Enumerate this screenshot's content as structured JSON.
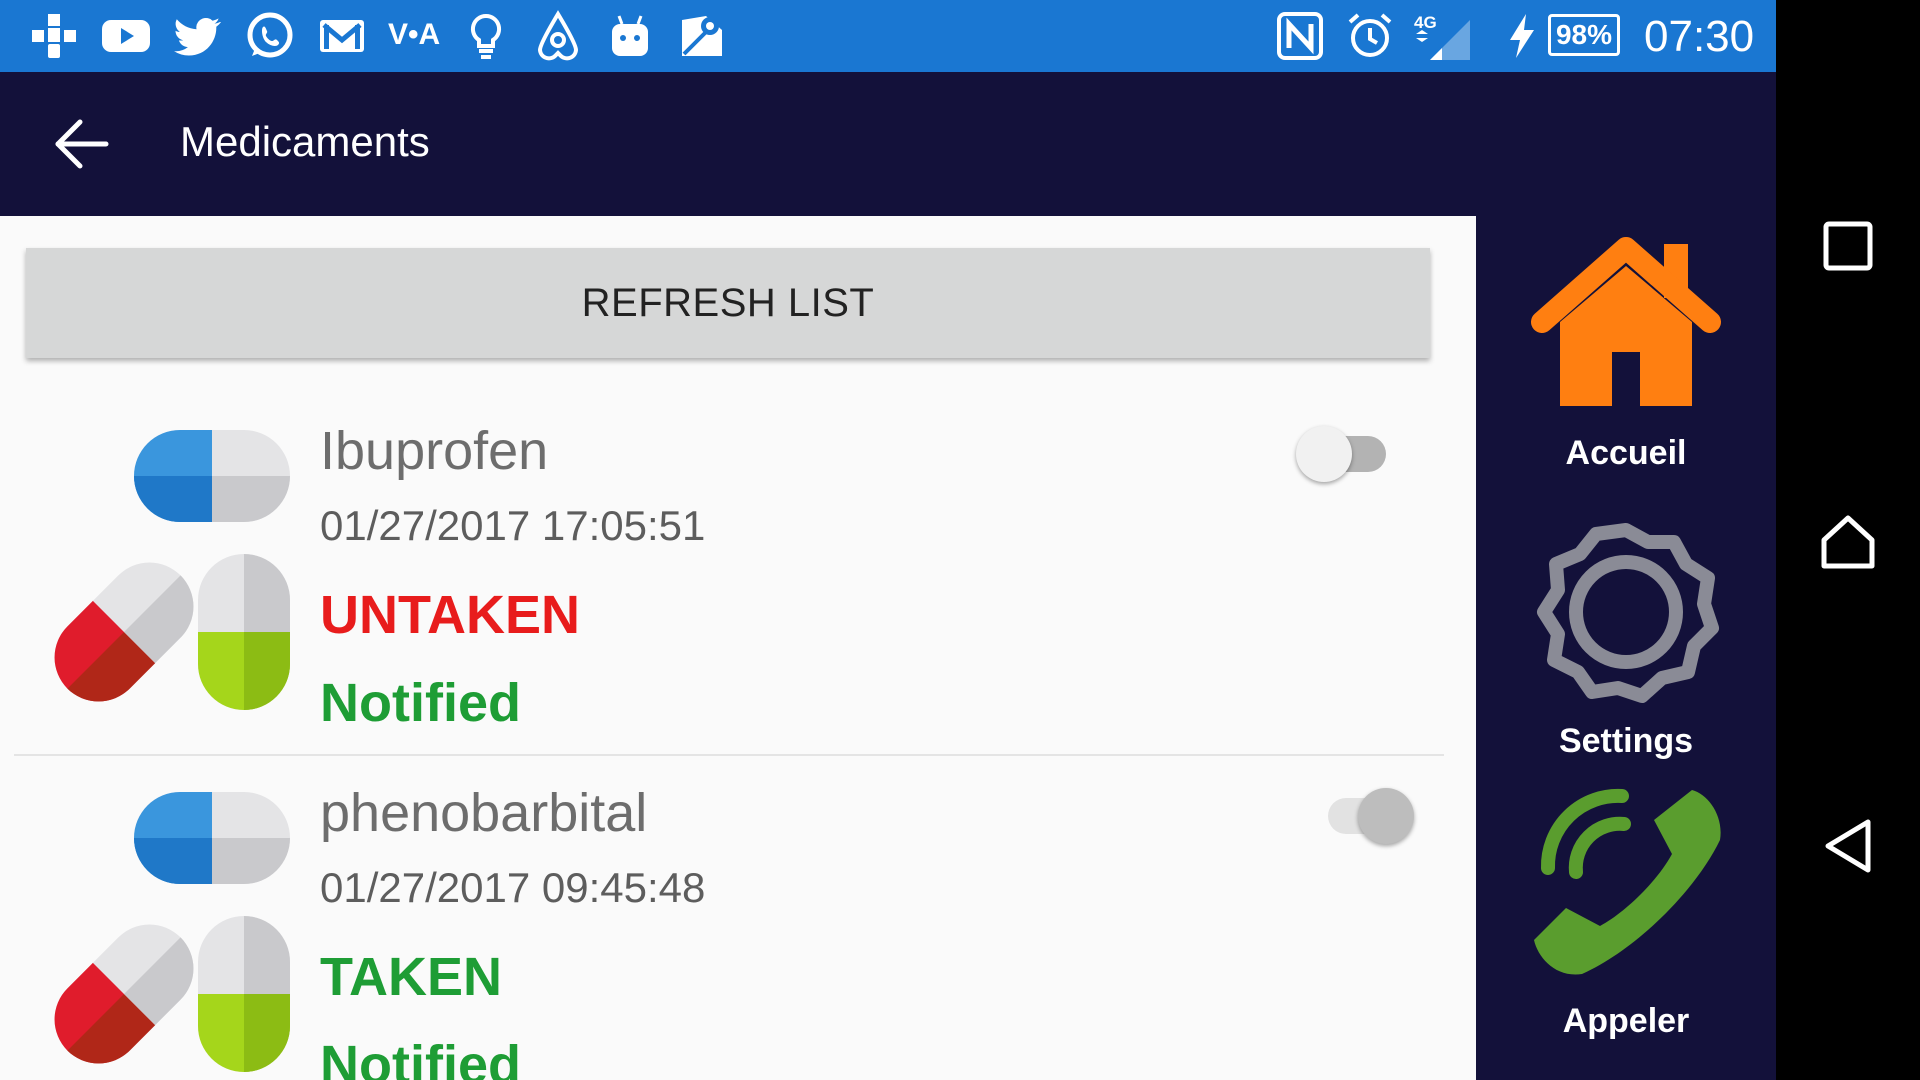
{
  "status_bar": {
    "left_icons": [
      "tree-icon",
      "youtube-icon",
      "twitter-icon",
      "whatsapp-icon",
      "gmail-icon",
      "vea-icon",
      "lightbulb-icon",
      "airbnb-icon",
      "android-icon",
      "maps-icon"
    ],
    "right_icons": [
      "nfc-icon",
      "alarm-icon",
      "signal-4g-icon",
      "charging-icon"
    ],
    "vea_label": "V•A",
    "network": "4G",
    "battery": "98%",
    "time": "07:30"
  },
  "app_bar": {
    "title": "Medicaments"
  },
  "refresh_button": {
    "label": "REFRESH LIST"
  },
  "medications": [
    {
      "name": "Ibuprofen",
      "datetime": "01/27/2017 17:05:51",
      "status": "UNTAKEN",
      "status_color": "#e81c1c",
      "notification": "Notified",
      "toggle_on": false
    },
    {
      "name": "phenobarbital",
      "datetime": "01/27/2017 09:45:48",
      "status": "TAKEN",
      "status_color": "#1e9d35",
      "notification": "Notified",
      "toggle_on": false
    }
  ],
  "side_nav": [
    {
      "label": "Accueil",
      "icon": "home-icon"
    },
    {
      "label": "Settings",
      "icon": "gear-icon"
    },
    {
      "label": "Appeler",
      "icon": "phone-icon"
    }
  ],
  "system_nav": [
    "recents-icon",
    "home-icon",
    "back-icon"
  ],
  "colors": {
    "status_bar": "#1a77d2",
    "app_bar": "#13113a",
    "home_orange": "#ff7f11",
    "phone_green": "#5a9d2e",
    "gear_grey": "#8a8b96",
    "notified_green": "#1e9d35"
  }
}
